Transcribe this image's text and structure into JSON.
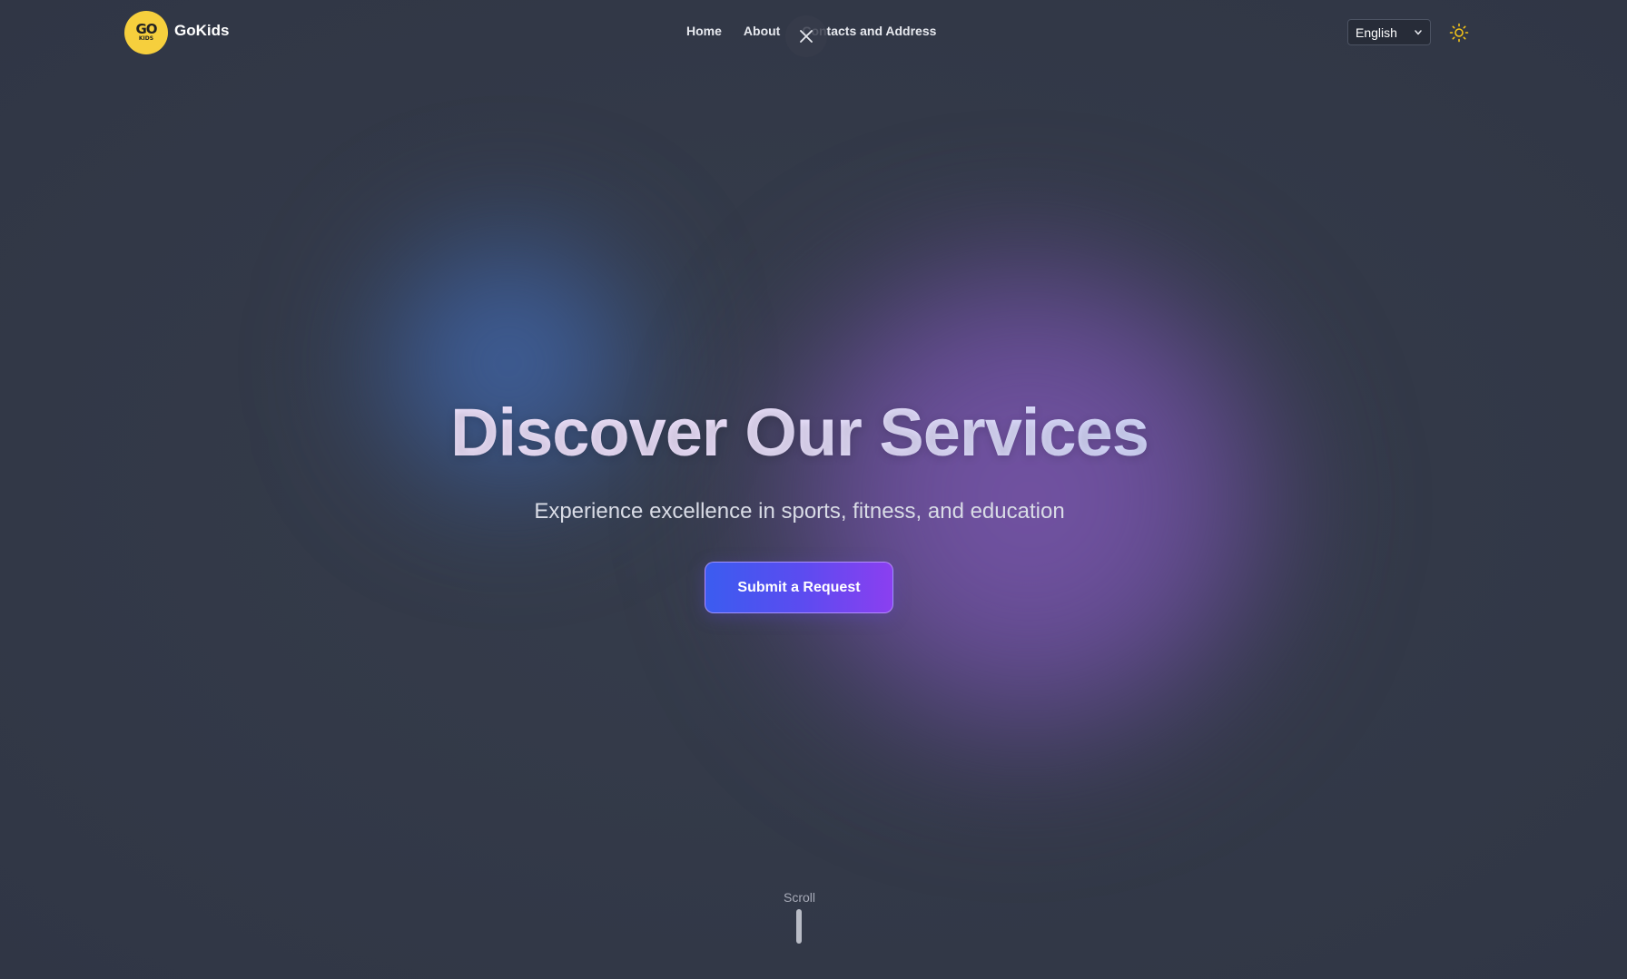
{
  "header": {
    "logo": {
      "line1": "GO",
      "line2": "KIDS"
    },
    "brand": "GoKids",
    "nav": [
      {
        "label": "Home"
      },
      {
        "label": "About"
      },
      {
        "label": "Contacts and Address"
      }
    ],
    "language": {
      "selected": "English"
    },
    "theme_toggle_icon": "sun-icon",
    "close_icon": "close-icon"
  },
  "hero": {
    "title": "Discover Our Services",
    "subtitle": "Experience excellence in sports, fitness, and education",
    "cta_label": "Submit a Request"
  },
  "scroll": {
    "label": "Scroll"
  },
  "colors": {
    "background": "#343b4a",
    "logo_yellow": "#f6cf3d",
    "cta_start": "#3b5cf0",
    "cta_end": "#8b3ff0",
    "sun_icon": "#f5c518"
  }
}
